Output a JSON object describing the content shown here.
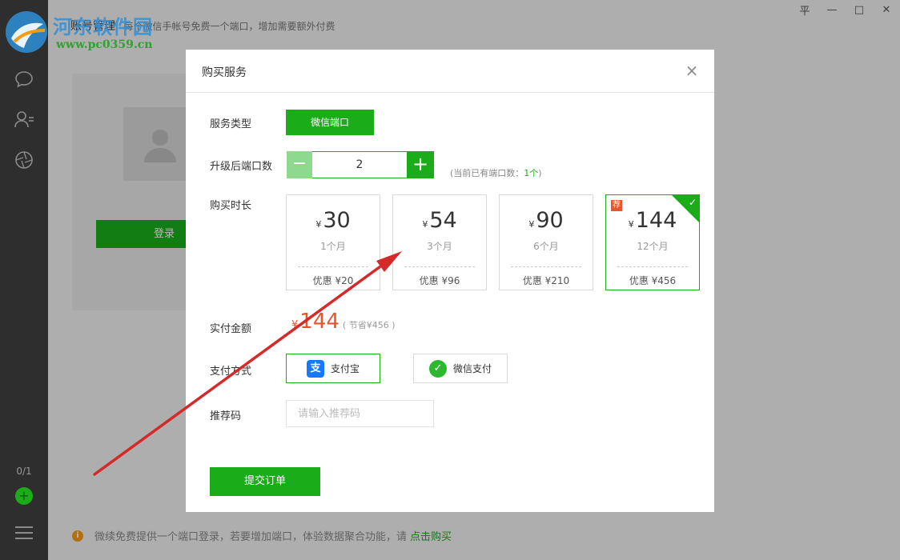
{
  "watermark": {
    "title": "河东软件园",
    "url": "www.pc0359.cn"
  },
  "window": {
    "controls": [
      "平",
      "—",
      "□",
      "✕"
    ]
  },
  "header": {
    "title": "账号管理",
    "subtitle": "每个微信手帐号免费一个端口，增加需要额外付费"
  },
  "sidebar": {
    "count": "0/1"
  },
  "account_card": {
    "login_label": "登录"
  },
  "notice": {
    "text": "微续免费提供一个端口登录，若要增加端口，体验数据聚合功能，请",
    "link": "点击购买"
  },
  "dialog": {
    "title": "购买服务",
    "service_type": {
      "label": "服务类型",
      "value": "微信端口"
    },
    "ports": {
      "label": "升级后端口数",
      "value": "2",
      "hint_prefix": "(当前已有端口数：",
      "hint_current": "1个",
      "hint_suffix": ")"
    },
    "duration": {
      "label": "购买时长",
      "plans": [
        {
          "yen": "¥",
          "price": "30",
          "months": "1个月",
          "discount": "优惠 ¥20"
        },
        {
          "yen": "¥",
          "price": "54",
          "months": "3个月",
          "discount": "优惠 ¥96"
        },
        {
          "yen": "¥",
          "price": "90",
          "months": "6个月",
          "discount": "优惠 ¥210"
        },
        {
          "yen": "¥",
          "price": "144",
          "months": "12个月",
          "discount": "优惠 ¥456",
          "badge": "荐",
          "selected": true
        }
      ]
    },
    "amount": {
      "label": "实付金额",
      "yen": "¥",
      "value": "144",
      "save": "( 节省¥456 )"
    },
    "payment": {
      "label": "支付方式",
      "alipay": "支付宝",
      "alipay_glyph": "支",
      "wechat": "微信支付"
    },
    "referral": {
      "label": "推荐码",
      "placeholder": "请输入推荐码"
    },
    "submit_label": "提交订单"
  },
  "colors": {
    "accent": "#1aad19",
    "price_red": "#e8542e",
    "sidebar_bg": "#2e2e2e",
    "annotation_arrow": "#d42a2a"
  }
}
